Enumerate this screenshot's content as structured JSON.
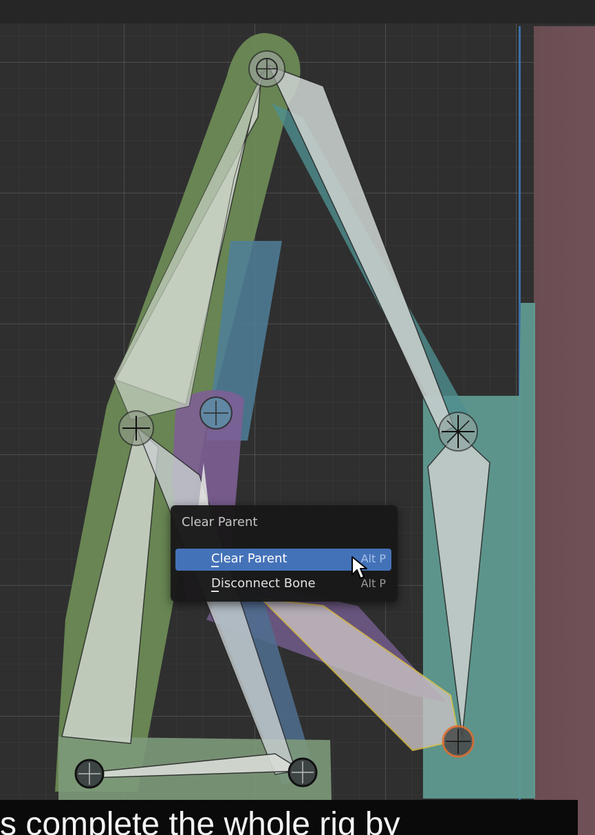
{
  "viewport": {
    "accent_color": "#4472b8",
    "selected_bone_color": "#e6c84a",
    "active_joint_color": "#e06a2a"
  },
  "context_menu": {
    "title": "Clear Parent",
    "items": [
      {
        "label": "Clear Parent",
        "shortcut": "Alt P",
        "highlighted": true
      },
      {
        "label": "Disconnect Bone",
        "shortcut": "Alt P",
        "highlighted": false
      }
    ]
  },
  "subtitle": {
    "text": "s complete the whole rig by"
  }
}
